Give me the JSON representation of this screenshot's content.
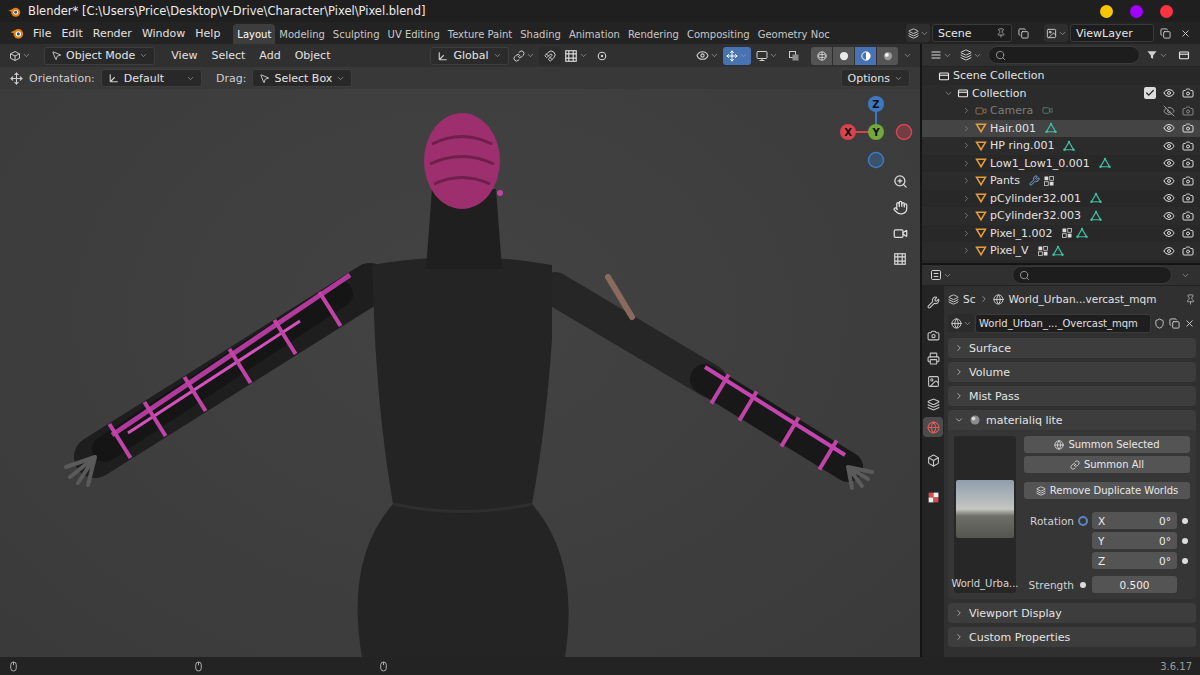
{
  "window": {
    "title": "Blender* [C:\\Users\\Price\\Desktop\\V-Drive\\Character\\Pixel\\Pixel.blend]",
    "buttons": [
      {
        "color": "#f7c600"
      },
      {
        "color": "#a100ff"
      },
      {
        "color": "#ff3344"
      }
    ]
  },
  "menu": [
    "File",
    "Edit",
    "Render",
    "Window",
    "Help"
  ],
  "workspaces": [
    {
      "label": "Layout",
      "selected": true
    },
    {
      "label": "Modeling",
      "selected": false
    },
    {
      "label": "Sculpting",
      "selected": false
    },
    {
      "label": "UV Editing",
      "selected": false
    },
    {
      "label": "Texture Paint",
      "selected": false
    },
    {
      "label": "Shading",
      "selected": false
    },
    {
      "label": "Animation",
      "selected": false
    },
    {
      "label": "Rendering",
      "selected": false
    },
    {
      "label": "Compositing",
      "selected": false
    },
    {
      "label": "Geometry Noc",
      "selected": false
    }
  ],
  "scene": {
    "name": "Scene"
  },
  "view_layer": {
    "name": "ViewLayer"
  },
  "viewport_header": {
    "mode": "Object Mode",
    "menus": [
      "View",
      "Select",
      "Add",
      "Object"
    ],
    "orientation": "Global",
    "shading": [
      {
        "kind": "wireframe",
        "selected": false
      },
      {
        "kind": "solid",
        "selected": false
      },
      {
        "kind": "material",
        "selected": true
      },
      {
        "kind": "rendered",
        "selected": false
      }
    ]
  },
  "tool_settings": {
    "orientation_label": "Orientation:",
    "orientation": "Default",
    "drag_label": "Drag:",
    "drag": "Select Box",
    "options": "Options"
  },
  "gizmo": {
    "axes": [
      {
        "label": "Z",
        "color": "#3c79c2"
      },
      {
        "label": "X",
        "color": "#d9434f"
      },
      {
        "label": "Y",
        "color": "#74a83a"
      }
    ]
  },
  "outliner": {
    "root": "Scene Collection",
    "collection": {
      "name": "Collection",
      "expanded": true,
      "checked": true
    },
    "items": [
      {
        "name": "Camera",
        "kind": "camera",
        "selected": false,
        "disabled": true,
        "visible": false,
        "extras": [
          "camera-data"
        ]
      },
      {
        "name": "Hair.001",
        "kind": "mesh",
        "selected": true,
        "disabled": false,
        "visible": true,
        "extras": [
          "mesh"
        ]
      },
      {
        "name": "HP ring.001",
        "kind": "mesh",
        "selected": false,
        "disabled": false,
        "visible": true,
        "extras": [
          "mesh"
        ]
      },
      {
        "name": "Low1_Low1_0.001",
        "kind": "mesh",
        "selected": false,
        "disabled": false,
        "visible": true,
        "extras": [
          "mesh"
        ]
      },
      {
        "name": "Pants",
        "kind": "mesh",
        "selected": false,
        "disabled": false,
        "visible": true,
        "extras": [
          "wrench",
          "groups"
        ]
      },
      {
        "name": "pCylinder32.001",
        "kind": "mesh",
        "selected": false,
        "disabled": false,
        "visible": true,
        "extras": [
          "mesh"
        ]
      },
      {
        "name": "pCylinder32.003",
        "kind": "mesh",
        "selected": false,
        "disabled": false,
        "visible": true,
        "extras": [
          "mesh"
        ]
      },
      {
        "name": "Pixel_1.002",
        "kind": "mesh",
        "selected": false,
        "disabled": false,
        "visible": true,
        "extras": [
          "groups",
          "mesh"
        ]
      },
      {
        "name": "Pixel_V",
        "kind": "mesh",
        "selected": false,
        "disabled": false,
        "visible": true,
        "extras": [
          "groups",
          "mesh"
        ]
      }
    ]
  },
  "properties": {
    "tabs": [
      {
        "kind": "tool",
        "selected": false
      },
      {
        "kind": "render",
        "selected": false
      },
      {
        "kind": "output",
        "selected": false
      },
      {
        "kind": "view-layer",
        "selected": false
      },
      {
        "kind": "scene",
        "selected": false
      },
      {
        "kind": "world",
        "selected": true
      },
      {
        "kind": "collection",
        "selected": false
      },
      {
        "kind": "texture",
        "selected": false
      }
    ],
    "breadcrumb": [
      "Sc",
      "World_Urban...vercast_mqm"
    ],
    "world": "World_Urban_..._Overcast_mqm",
    "panels_top": [
      {
        "label": "Surface",
        "expanded": false
      },
      {
        "label": "Volume",
        "expanded": false
      },
      {
        "label": "Mist Pass",
        "expanded": false
      }
    ],
    "addon": {
      "label": "materialiq lite",
      "expanded": true,
      "preview_caption": "World_Urba...",
      "buttons": [
        "Summon Selected",
        "Summon All",
        "Remove Duplicate Worlds"
      ],
      "rotation": {
        "label": "Rotation",
        "axes": [
          {
            "label": "X",
            "value": "0°"
          },
          {
            "label": "Y",
            "value": "0°"
          },
          {
            "label": "Z",
            "value": "0°"
          }
        ]
      },
      "strength": {
        "label": "Strength",
        "value": "0.500"
      }
    },
    "panels_bottom": [
      {
        "label": "Viewport Display",
        "expanded": false
      },
      {
        "label": "Custom Properties",
        "expanded": false
      }
    ]
  },
  "status_bar": {
    "version": "3.6.17"
  }
}
